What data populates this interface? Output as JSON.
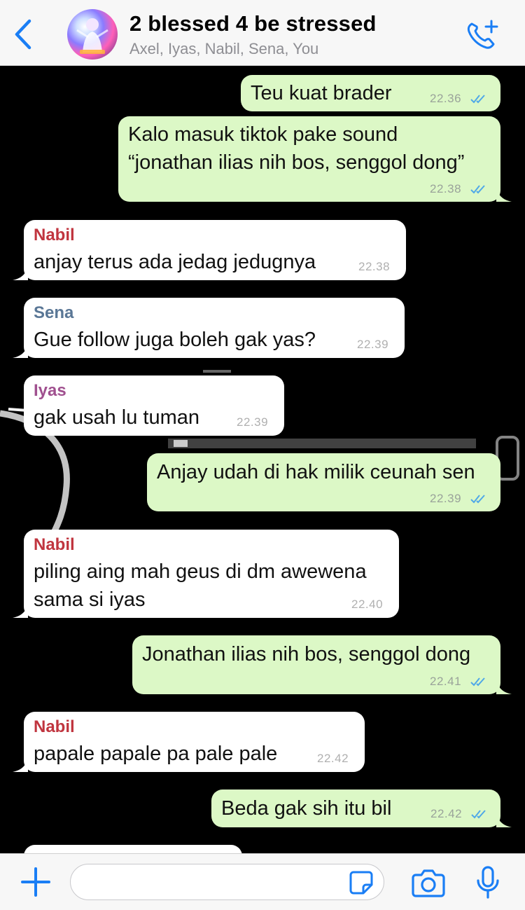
{
  "header": {
    "title": "2 blessed 4 be stressed",
    "participants": "Axel, Iyas, Nabil, Sena, You",
    "back_icon": "chevron-left-icon",
    "call_icon": "add-call-icon",
    "accent_color": "#1a7ef5"
  },
  "messages": [
    {
      "direction": "out",
      "text": "Teu kuat brader",
      "time": "22.36",
      "status": "read"
    },
    {
      "direction": "out",
      "lines": [
        "Kalo masuk tiktok pake sound",
        "“jonathan ilias nih bos, senggol dong”"
      ],
      "time": "22.38",
      "status": "read"
    },
    {
      "direction": "in",
      "sender": "Nabil",
      "sender_color": "#c0353f",
      "text": "anjay terus ada jedag jedugnya",
      "time": "22.38"
    },
    {
      "direction": "in",
      "sender": "Sena",
      "sender_color": "#5a7796",
      "text": "Gue follow juga boleh gak yas?",
      "time": "22.39"
    },
    {
      "direction": "in",
      "sender": "Iyas",
      "sender_color": "#a0508f",
      "text": "gak usah lu tuman",
      "time": "22.39"
    },
    {
      "direction": "out",
      "text": "Anjay udah di hak milik ceunah sen",
      "time": "22.39",
      "status": "read"
    },
    {
      "direction": "in",
      "sender": "Nabil",
      "sender_color": "#c0353f",
      "lines": [
        "piling aing mah geus di dm awewena",
        "sama si iyas"
      ],
      "time": "22.40"
    },
    {
      "direction": "out",
      "text": "Jonathan ilias nih bos, senggol dong",
      "time": "22.41",
      "status": "read"
    },
    {
      "direction": "in",
      "sender": "Nabil",
      "sender_color": "#c0353f",
      "text": "papale papale pa pale pale",
      "time": "22.42"
    },
    {
      "direction": "out",
      "text": "Beda gak sih itu bil",
      "time": "22.42",
      "status": "read"
    }
  ],
  "footer": {
    "input_value": "",
    "plus_icon": "plus-icon",
    "sticker_icon": "sticker-icon",
    "camera_icon": "camera-icon",
    "mic_icon": "microphone-icon"
  },
  "colors": {
    "outgoing_bubble": "#dcf8c6",
    "incoming_bubble": "#ffffff",
    "read_ticks": "#4fa8e8"
  }
}
